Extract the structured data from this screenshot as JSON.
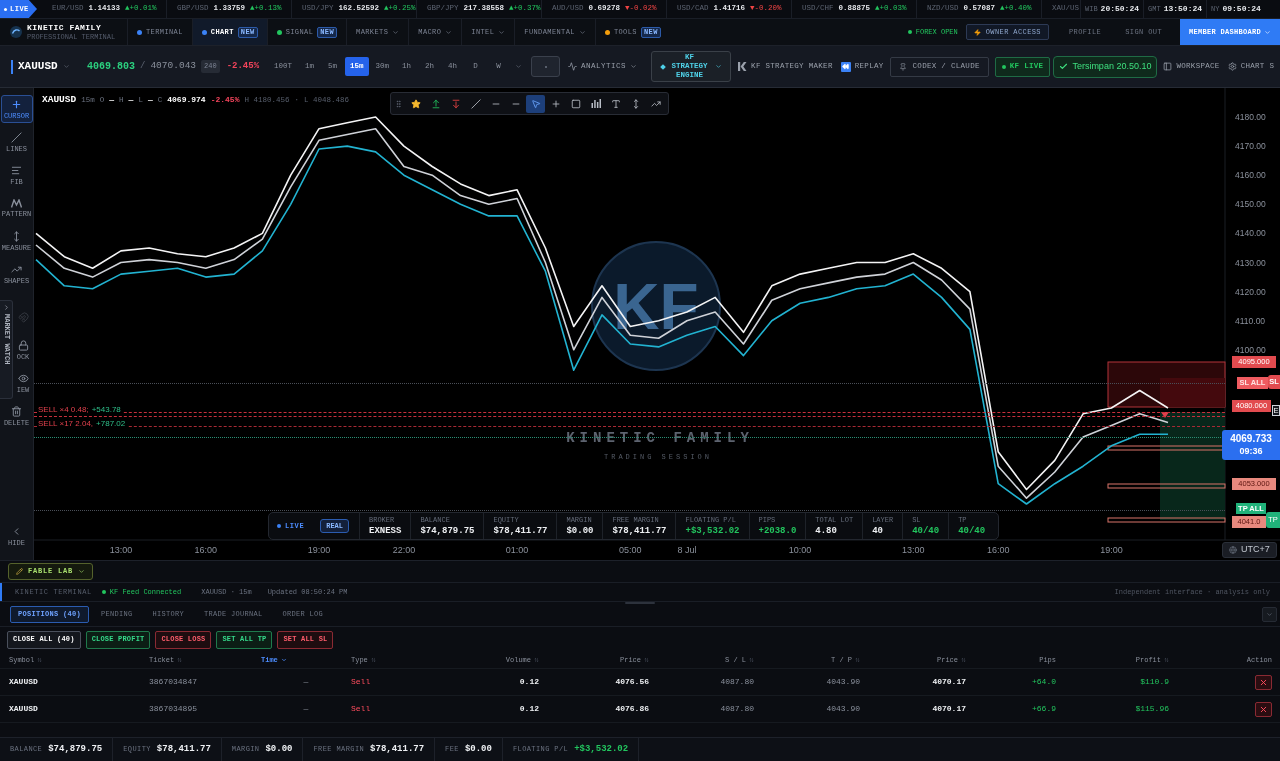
{
  "ticker": {
    "live": "LIVE",
    "quotes": [
      {
        "pair": "EUR/USD",
        "price": "1.14133",
        "change": "▲+0.01%",
        "rising": true
      },
      {
        "pair": "GBP/USD",
        "price": "1.33759",
        "change": "▲+0.13%",
        "rising": true
      },
      {
        "pair": "USD/JPY",
        "price": "162.52592",
        "change": "▲+0.25%",
        "rising": true
      },
      {
        "pair": "GBP/JPY",
        "price": "217.38558",
        "change": "▲+0.37%",
        "rising": true
      },
      {
        "pair": "AUD/USD",
        "price": "0.69278",
        "change": "▼-0.02%",
        "rising": false
      },
      {
        "pair": "USD/CAD",
        "price": "1.41716",
        "change": "▼-0.20%",
        "rising": false
      },
      {
        "pair": "USD/CHF",
        "price": "0.88875",
        "change": "▲+0.03%",
        "rising": true
      },
      {
        "pair": "NZD/USD",
        "price": "0.57087",
        "change": "▲+0.40%",
        "rising": true
      },
      {
        "pair": "XAU/US"
      }
    ],
    "clocks": [
      {
        "zone": "WIB",
        "time": "20:50:24"
      },
      {
        "zone": "GMT",
        "time": "13:50:24"
      },
      {
        "zone": "NY",
        "time": "09:50:24"
      }
    ]
  },
  "nav": {
    "brand": "KINETIC FAMILY",
    "tagline": "PROFESSIONAL TERMINAL",
    "tabs": [
      {
        "label": "TERMINAL",
        "selected": false,
        "menu": false,
        "color": "#3b82f6"
      },
      {
        "label": "CHART",
        "selected": true,
        "menu": false,
        "color": "#3b82f6",
        "badge": "NEW"
      },
      {
        "label": "SIGNAL",
        "selected": false,
        "menu": false,
        "color": "#22c55e",
        "badge": "NEW"
      },
      {
        "label": "MARKETS",
        "selected": false,
        "menu": true
      },
      {
        "label": "MACRO",
        "selected": false,
        "menu": true
      },
      {
        "label": "INTEL",
        "selected": false,
        "menu": true
      },
      {
        "label": "FUNDAMENTAL",
        "selected": false,
        "menu": true
      },
      {
        "label": "TOOLS",
        "selected": false,
        "menu": false,
        "color": "#f59e0b",
        "badge": "NEW"
      }
    ],
    "market_status": "FOREX OPEN",
    "owner_access": "OWNER ACCESS",
    "links": [
      "PROFILE",
      "SIGN OUT"
    ],
    "dashboard": "MEMBER DASHBOARD"
  },
  "toolbar": {
    "symbol": "XAUUSD",
    "bid": "4069.803",
    "separator": "/",
    "ask": "4070.043",
    "spread": "240",
    "change": "-2.45%",
    "timeframes": [
      {
        "label": "100T",
        "selected": false
      },
      {
        "label": "1m",
        "selected": false
      },
      {
        "label": "5m",
        "selected": false
      },
      {
        "label": "15m",
        "selected": true
      },
      {
        "label": "30m",
        "selected": false
      },
      {
        "label": "1h",
        "selected": false
      },
      {
        "label": "2h",
        "selected": false
      },
      {
        "label": "4h",
        "selected": false
      },
      {
        "label": "D",
        "selected": false
      },
      {
        "label": "W",
        "selected": false
      }
    ],
    "tools": [
      {
        "kind": "menu",
        "label": "ANALYTICS"
      },
      {
        "kind": "engine",
        "label": "KF STRATEGY ENGINE"
      },
      {
        "kind": "plain",
        "label": "KF STRATEGY MAKER"
      },
      {
        "kind": "plain",
        "label": "REPLAY"
      },
      {
        "kind": "outlined",
        "label": "CODEX / CLAUDE"
      },
      {
        "kind": "live",
        "label": "KF LIVE"
      },
      {
        "kind": "saved",
        "label": "Tersimpan 20.50.10"
      },
      {
        "kind": "plain",
        "label": "WORKSPACE"
      },
      {
        "kind": "plain",
        "label": "CHART S"
      }
    ]
  },
  "left_tools": [
    {
      "label": "CURSOR",
      "selected": true,
      "disabled": false
    },
    {
      "label": "LINES",
      "selected": false,
      "disabled": false
    },
    {
      "label": "FIB",
      "selected": false,
      "disabled": false
    },
    {
      "label": "PATTERN",
      "selected": false,
      "disabled": false
    },
    {
      "label": "MEASURE",
      "selected": false,
      "disabled": false
    },
    {
      "label": "SHAPES",
      "selected": false,
      "disabled": false
    },
    {
      "selected": false,
      "disabled": true
    },
    {
      "label": "OCK",
      "selected": false,
      "disabled": false
    },
    {
      "label": "IEW",
      "selected": false,
      "disabled": false
    },
    {
      "label": "DELETE",
      "selected": false,
      "disabled": false
    },
    {
      "label": "HIDE",
      "selected": false,
      "disabled": false
    }
  ],
  "market_watch": "MARKET WATCH",
  "chart": {
    "legend": {
      "symbol": "XAUUSD",
      "interval": "15m",
      "ohlc": [
        {
          "key": "O",
          "value": "—"
        },
        {
          "key": "H",
          "value": "—"
        },
        {
          "key": "L",
          "value": "—"
        },
        {
          "key": "C",
          "value": "4069.974"
        }
      ],
      "change": "-2.45%",
      "high": "H 4180.456",
      "separator": "·",
      "low": "L 4048.486"
    },
    "drawing_tools": [
      {
        "selected": false
      },
      {
        "selected": false
      },
      {
        "selected": false
      },
      {
        "selected": false
      },
      {
        "selected": false
      },
      {
        "selected": false
      },
      {
        "selected": true
      },
      {
        "selected": false
      },
      {
        "selected": false
      },
      {
        "selected": false
      },
      {
        "selected": false
      },
      {
        "selected": false
      },
      {
        "selected": false
      }
    ],
    "watermark": {
      "logo": "KF",
      "title": "KINETIC FAMILY",
      "subtitle": "TRADING SESSION"
    },
    "order_labels": [
      {
        "side": "SELL ×4 0.48;",
        "pl": "+543.78"
      },
      {
        "side": "SELL ×17 2.04,",
        "pl": "+787.02"
      }
    ],
    "price_tags": [
      {
        "text": "4095.000",
        "kind": "sl"
      },
      {
        "text": "SL ALL",
        "kind": "sl_all"
      },
      {
        "text": "SL",
        "kind": "sl_edge"
      },
      {
        "text": "4080.000",
        "kind": "sl"
      },
      {
        "text": "E",
        "kind": "edge"
      },
      {
        "text": "4053.000",
        "kind": "tp"
      },
      {
        "text": "TP ALL",
        "kind": "tp_all"
      },
      {
        "text": "4041.0",
        "kind": "tp"
      },
      {
        "text": "TP",
        "kind": "tp_edge"
      }
    ],
    "current_price": {
      "price": "4069.733",
      "countdown": "09:36"
    },
    "timezone": "UTC+7",
    "chart_data": {
      "type": "line",
      "categories": [
        null,
        null,
        null,
        "13:00",
        null,
        null,
        "16:00",
        null,
        null,
        null,
        "19:00",
        null,
        null,
        "22:00",
        null,
        null,
        null,
        "01:00",
        null,
        null,
        null,
        "05:00",
        null,
        "8 Jul",
        null,
        null,
        null,
        "10:00",
        null,
        null,
        null,
        "13:00",
        null,
        null,
        "16:00",
        null,
        null,
        null,
        "19:00",
        null,
        null
      ],
      "series": [
        {
          "color": "#f4f4f5",
          "values": [
            4140,
            4132,
            4128,
            4134,
            4135,
            4133,
            4132,
            4135,
            4140,
            4160,
            4176,
            4178,
            4180,
            4170,
            4163,
            4157,
            4153,
            4155,
            4135,
            4108,
            4122,
            4108,
            4110,
            4113,
            4118,
            4106,
            4122,
            4126,
            4128,
            4130,
            4130,
            4133,
            4128,
            4120,
            4065,
            4052,
            4062,
            4078,
            4080,
            4086,
            4080
          ]
        },
        {
          "color": "#cfd2d8",
          "values": [
            4136,
            4128,
            4125,
            4130,
            4131,
            4130,
            4128,
            4131,
            4138,
            4156,
            4172,
            4174,
            4176,
            4163,
            4160,
            4153,
            4150,
            4152,
            4130,
            4100,
            4118,
            4105,
            4104,
            4110,
            4113,
            4102,
            4117,
            4121,
            4123,
            4125,
            4126,
            4130,
            4124,
            4114,
            4060,
            4049,
            4058,
            4070,
            4074,
            4078,
            4075
          ]
        },
        {
          "color": "#22b3d1",
          "values": [
            4131,
            4122,
            4121,
            4126,
            4127,
            4128,
            4125,
            4126,
            4134,
            4150,
            4169,
            4170,
            4168,
            4160,
            4155,
            4150,
            4146,
            4146,
            4127,
            4093,
            4112,
            4102,
            4101,
            4105,
            4108,
            4098,
            4110,
            4116,
            4118,
            4121,
            4122,
            4126,
            4118,
            4107,
            4054,
            4047,
            4054,
            4060,
            4067,
            4071,
            4071
          ]
        }
      ],
      "ylim": [
        4034.64,
        4189.97
      ],
      "yticks": [
        {
          "value": 4100,
          "label": "4100.00"
        },
        {
          "value": 4110,
          "label": "4110.00"
        },
        {
          "value": 4120,
          "label": "4120.00"
        },
        {
          "value": 4130,
          "label": "4130.00"
        },
        {
          "value": 4140,
          "label": "4140.00"
        },
        {
          "value": 4150,
          "label": "4150.00"
        },
        {
          "value": 4160,
          "label": "4160.00"
        },
        {
          "value": 4170,
          "label": "4170.00"
        },
        {
          "value": 4180,
          "label": "4180.00"
        }
      ]
    },
    "stats": {
      "status": "LIVE",
      "account": "REAL",
      "items": [
        {
          "label": "BROKER",
          "value": "EXNESS",
          "positive": false
        },
        {
          "label": "BALANCE",
          "value": "$74,879.75",
          "positive": false
        },
        {
          "label": "EQUITY",
          "value": "$78,411.77",
          "positive": false
        },
        {
          "label": "MARGIN",
          "value": "$0.00",
          "positive": false
        },
        {
          "label": "FREE MARGIN",
          "value": "$78,411.77",
          "positive": false
        },
        {
          "label": "FLOATING P/L",
          "value": "+$3,532.02",
          "positive": true
        },
        {
          "label": "PIPS",
          "value": "+2038.0",
          "positive": true
        },
        {
          "label": "TOTAL LOT",
          "value": "4.80",
          "positive": false
        },
        {
          "label": "LAYER",
          "value": "40",
          "positive": false
        },
        {
          "label": "SL",
          "value": "40/40",
          "positive": true
        },
        {
          "label": "TP",
          "value": "40/40",
          "positive": true
        }
      ]
    }
  },
  "lab": {
    "label": "FABLE LAB"
  },
  "status": {
    "terminal": "KINETIC TERMINAL",
    "feed": "KF Feed Connected",
    "symbol": "XAUUSD · 15m",
    "updated": "Updated 08:50:24 PM",
    "note": "Independent interface · analysis only"
  },
  "positions": {
    "tabs": [
      {
        "label": "POSITIONS (40)",
        "selected": true
      },
      {
        "label": "PENDING",
        "selected": false
      },
      {
        "label": "HISTORY",
        "selected": false
      },
      {
        "label": "TRADE JOURNAL",
        "selected": false
      },
      {
        "label": "ORDER LOG",
        "selected": false
      }
    ],
    "actions": [
      {
        "label": "CLOSE ALL (40)",
        "kind": "neutral"
      },
      {
        "label": "CLOSE PROFIT",
        "kind": "profit"
      },
      {
        "label": "CLOSE LOSS",
        "kind": "loss"
      },
      {
        "label": "SET ALL TP",
        "kind": "profit"
      },
      {
        "label": "SET ALL SL",
        "kind": "loss"
      }
    ],
    "table": {
      "columns": [
        {
          "label": "Symbol",
          "sortable": true,
          "sorted": false
        },
        {
          "label": "Ticket",
          "sortable": true,
          "sorted": false
        },
        {
          "label": "Time",
          "sortable": true,
          "sorted": true
        },
        {
          "label": "Type",
          "sortable": true,
          "sorted": false
        },
        {
          "label": "Volume",
          "sortable": true,
          "sorted": false
        },
        {
          "label": "Price",
          "sortable": true,
          "sorted": false
        },
        {
          "label": "S / L",
          "sortable": true,
          "sorted": false
        },
        {
          "label": "T / P",
          "sortable": true,
          "sorted": false
        },
        {
          "label": "Price",
          "sortable": true,
          "sorted": false
        },
        {
          "label": "Pips",
          "sortable": false,
          "sorted": false
        },
        {
          "label": "Profit",
          "sortable": true,
          "sorted": false
        },
        {
          "label": "Action",
          "sortable": false,
          "sorted": false
        }
      ],
      "rows": [
        {
          "kind": "sell",
          "symbol": "XAUUSD",
          "ticket": "3867034847",
          "time": "—",
          "type": "Sell",
          "volume": "0.12",
          "price": "4076.56",
          "sl": "4087.80",
          "tp": "4043.90",
          "current": "4070.17",
          "pips": "+64.0",
          "profit": "$110.9",
          "positive": true
        },
        {
          "kind": "sell",
          "symbol": "XAUUSD",
          "ticket": "3867034895",
          "time": "—",
          "type": "Sell",
          "volume": "0.12",
          "price": "4076.86",
          "sl": "4087.80",
          "tp": "4043.90",
          "current": "4070.17",
          "pips": "+66.9",
          "profit": "$115.96",
          "positive": true
        }
      ]
    }
  },
  "footer": [
    {
      "label": "BALANCE",
      "value": "$74,879.75",
      "positive": false
    },
    {
      "label": "EQUITY",
      "value": "$78,411.77",
      "positive": false
    },
    {
      "label": "MARGIN",
      "value": "$0.00",
      "positive": false
    },
    {
      "label": "FREE MARGIN",
      "value": "$78,411.77",
      "positive": false
    },
    {
      "label": "FEE",
      "value": "$0.00",
      "positive": false
    },
    {
      "label": "FLOATING P/L",
      "value": "+$3,532.02",
      "positive": true
    }
  ]
}
